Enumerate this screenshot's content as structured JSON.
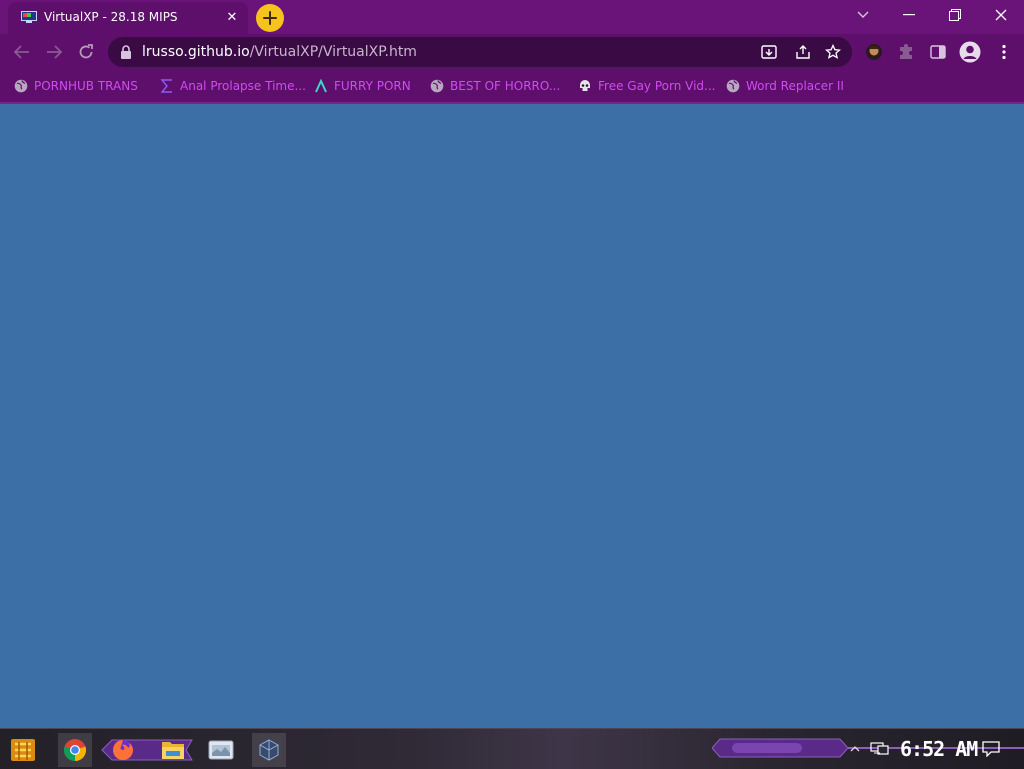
{
  "browser": {
    "tab": {
      "title": "VirtualXP - 28.18 MIPS",
      "close_glyph": "✕",
      "favicon": "monitor-icon"
    },
    "new_tab_icon": "plus-icon",
    "window_controls": [
      "chevron-down-icon",
      "minimize-icon",
      "restore-icon",
      "close-icon"
    ],
    "address_bar": {
      "host": "lrusso.github.io",
      "path": "/VirtualXP/VirtualXP.htm"
    },
    "toolbar_icons": [
      "back-icon",
      "forward-icon",
      "reload-icon",
      "lock-icon",
      "install-icon",
      "share-icon",
      "star-icon",
      "avatar-extension-icon",
      "puzzle-icon",
      "side-panel-icon",
      "profile-icon",
      "menu-icon"
    ],
    "bookmarks": [
      {
        "label": "PORNHUB TRANS",
        "icon": "globe-icon"
      },
      {
        "label": "Anal Prolapse Time...",
        "icon": "sigma-icon"
      },
      {
        "label": "FURRY PORN",
        "icon": "lambda-icon"
      },
      {
        "label": "BEST OF HORRO...",
        "icon": "globe-icon"
      },
      {
        "label": "Free Gay Porn Vid...",
        "icon": "skull-icon"
      },
      {
        "label": "Word Replacer II",
        "icon": "globe-icon"
      }
    ]
  },
  "taskbar": {
    "apps": [
      "start-icon",
      "chrome-icon",
      "firefox-icon",
      "folder-icon",
      "window-app-icon",
      "virtualbox-icon"
    ],
    "clock": "6:52 AM"
  },
  "colors": {
    "chrome_purple": "#5d0f6b",
    "title_purple": "#6a1378",
    "bookmark_text": "#d04cf0",
    "desktop_blue": "#3c6fa6"
  }
}
